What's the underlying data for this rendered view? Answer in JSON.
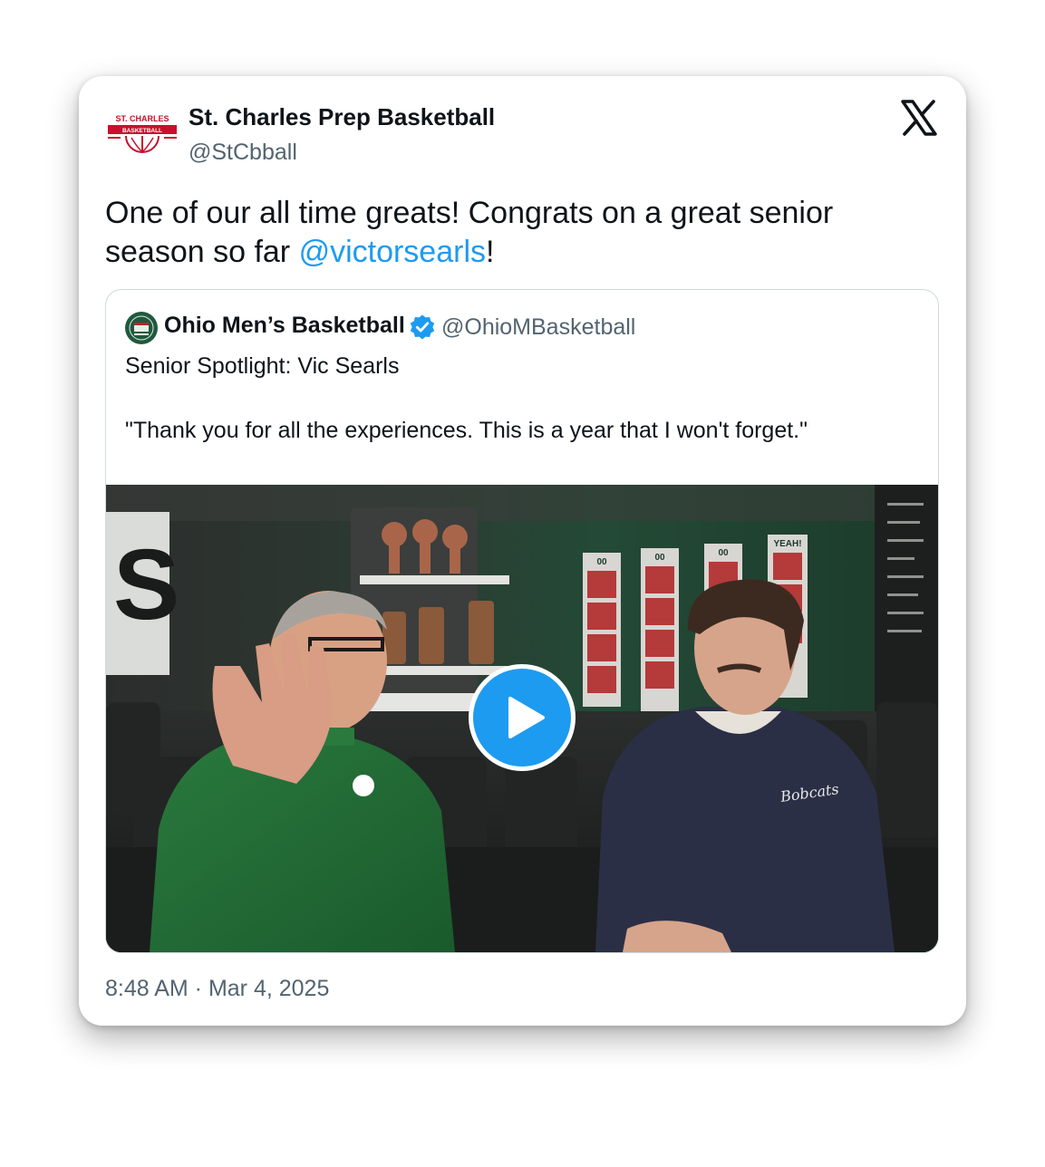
{
  "author": {
    "name": "St. Charles Prep Basketball",
    "handle": "@StCbball",
    "avatar_text_top": "ST. CHARLES",
    "avatar_text_banner": "BASKETBALL",
    "avatar_color": "#c8102e"
  },
  "tweet": {
    "text_before": "One of our all time greats! Congrats on a great senior season so far ",
    "mention": "@victorsearls",
    "text_after": "!",
    "timestamp": "8:48 AM · Mar 4, 2025"
  },
  "quoted": {
    "name": "Ohio Men’s Basketball",
    "handle": "@OhioMBasketball",
    "line1": "Senior Spotlight: Vic Searls",
    "line2": "\"Thank you for all the experiences. This is a year that I won't forget.\"",
    "video": {
      "icon": "play-icon",
      "wall_letter": "S",
      "hoodie_text": "Bobcats",
      "plaque_labels": [
        "00",
        "00",
        "00",
        "YEAH!"
      ]
    }
  },
  "colors": {
    "link": "#1d9bf0",
    "text": "#0f1419",
    "secondary": "#536471",
    "border": "#cfd9de"
  }
}
